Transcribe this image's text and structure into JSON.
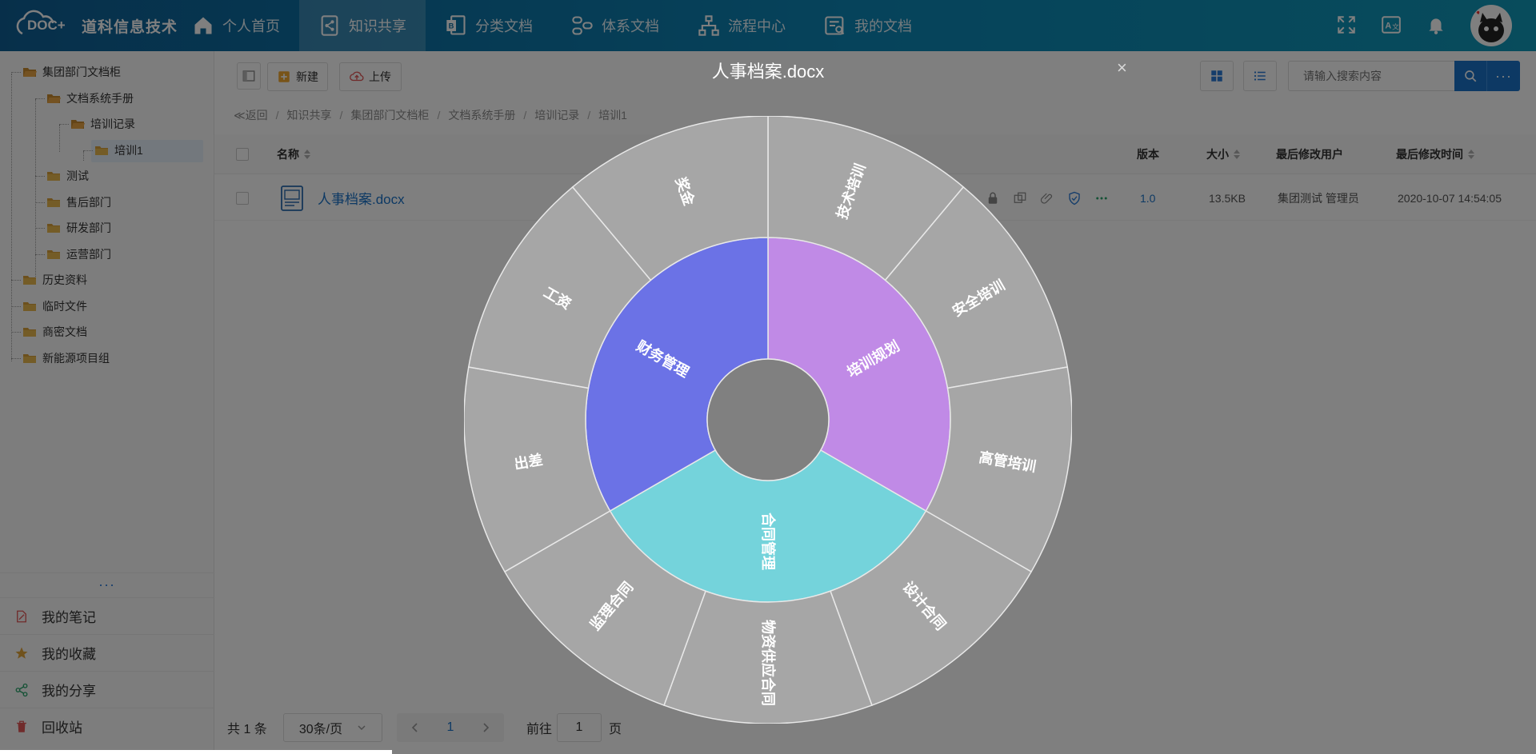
{
  "app": {
    "brand": "道科信息技术",
    "logo_text": "DOC+"
  },
  "nav": [
    {
      "label": "个人首页",
      "icon": "home-icon"
    },
    {
      "label": "知识共享",
      "icon": "share-doc-icon",
      "active": true
    },
    {
      "label": "分类文档",
      "icon": "category-doc-icon"
    },
    {
      "label": "体系文档",
      "icon": "system-doc-icon"
    },
    {
      "label": "流程中心",
      "icon": "flow-icon"
    },
    {
      "label": "我的文档",
      "icon": "my-doc-icon"
    }
  ],
  "top_tools": [
    "fullscreen-icon",
    "translate-icon",
    "bell-icon"
  ],
  "tree": [
    {
      "label": "集团部门文档柜",
      "level": 0,
      "icon": "folder-open-icon"
    },
    {
      "label": "文档系统手册",
      "level": 1,
      "icon": "folder-open-icon"
    },
    {
      "label": "培训记录",
      "level": 2,
      "icon": "folder-open-icon"
    },
    {
      "label": "培训1",
      "level": 3,
      "icon": "folder-icon",
      "selected": true
    },
    {
      "label": "测试",
      "level": 1,
      "icon": "folder-icon"
    },
    {
      "label": "售后部门",
      "level": 1,
      "icon": "folder-icon"
    },
    {
      "label": "研发部门",
      "level": 1,
      "icon": "folder-icon"
    },
    {
      "label": "运营部门",
      "level": 1,
      "icon": "folder-icon"
    },
    {
      "label": "历史资料",
      "level": 0,
      "icon": "folder-icon"
    },
    {
      "label": "临时文件",
      "level": 0,
      "icon": "folder-icon"
    },
    {
      "label": "商密文档",
      "level": 0,
      "icon": "folder-icon"
    },
    {
      "label": "新能源项目组",
      "level": 0,
      "icon": "folder-icon"
    }
  ],
  "sidebar_more": "...",
  "side_links": [
    {
      "label": "我的笔记",
      "icon": "note-icon",
      "color": "#e05757"
    },
    {
      "label": "我的收藏",
      "icon": "star-icon",
      "color": "#e0a43a"
    },
    {
      "label": "我的分享",
      "icon": "share-icon",
      "color": "#2aa36b"
    },
    {
      "label": "回收站",
      "icon": "trash-icon",
      "color": "#e05757"
    }
  ],
  "toolbar": {
    "new_label": "新建",
    "upload_label": "上传",
    "search_placeholder": "请输入搜索内容",
    "more_label": "···"
  },
  "breadcrumb": [
    "≪返回",
    "知识共享",
    "集团部门文档柜",
    "文档系统手册",
    "培训记录",
    "培训1"
  ],
  "table": {
    "columns": {
      "name": "名称",
      "version": "版本",
      "size": "大小",
      "modifier": "最后修改用户",
      "modified": "最后修改时间"
    },
    "rows": [
      {
        "name": "人事档案.docx",
        "version": "1.0",
        "size": "13.5KB",
        "modifier": "集团测试 管理员",
        "modified": "2020-10-07 14:54:05"
      }
    ]
  },
  "pager": {
    "total": "共 1 条",
    "page_size": "30条/页",
    "current": "1",
    "goto_label": "前往",
    "goto_value": "1",
    "page_suffix": "页"
  },
  "preview": {
    "title": "人事档案.docx",
    "close": "×"
  },
  "chart_data": {
    "type": "sunburst",
    "colors": {
      "inner": [
        "#c08ae6",
        "#74d3db",
        "#6b72e6"
      ],
      "outer": "#a6a6a6"
    },
    "inner": [
      {
        "name": "培训规划",
        "value": 4
      },
      {
        "name": "合同管理",
        "value": 4
      },
      {
        "name": "财务管理",
        "value": 4
      }
    ],
    "outer": [
      {
        "name": "技术培训",
        "parent": "培训规划",
        "value": 1
      },
      {
        "name": "安全培训",
        "parent": "培训规划",
        "value": 1
      },
      {
        "name": "高管培训",
        "parent": "培训规划",
        "value": 1
      },
      {
        "name": "设计合同",
        "parent": "合同管理",
        "value": 1
      },
      {
        "name": "物资供应合同",
        "parent": "合同管理",
        "value": 1
      },
      {
        "name": "监理合同",
        "parent": "合同管理",
        "value": 1
      },
      {
        "name": "出差",
        "parent": "财务管理",
        "value": 1
      },
      {
        "name": "工资",
        "parent": "财务管理",
        "value": 1
      },
      {
        "name": "奖金",
        "parent": "财务管理",
        "value": 1
      }
    ]
  }
}
